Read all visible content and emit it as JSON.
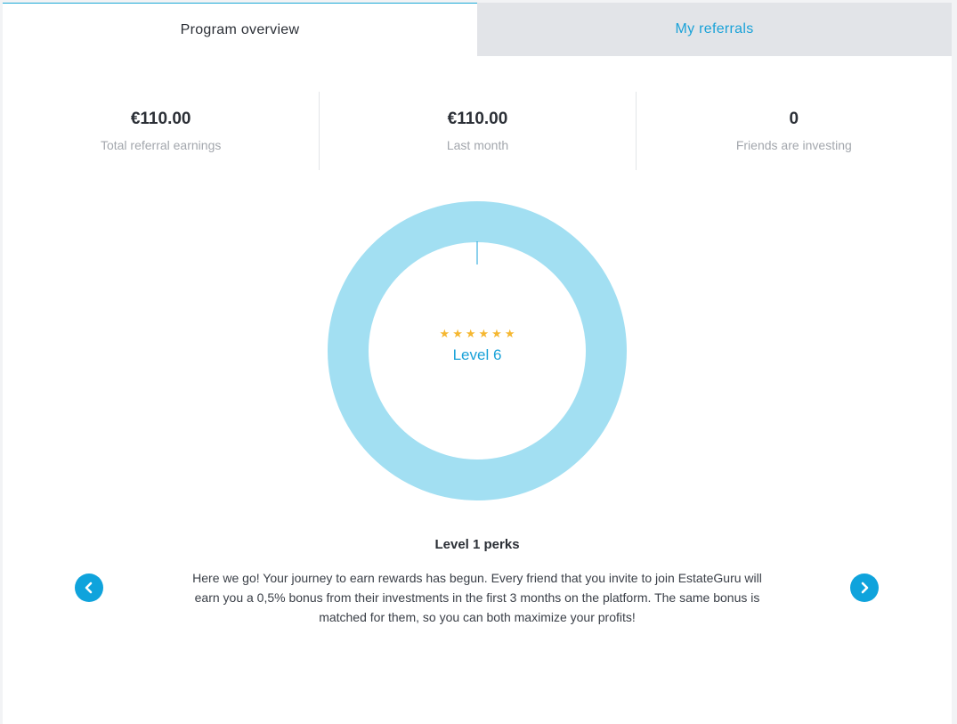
{
  "tabs": [
    {
      "label": "Program overview",
      "active": true
    },
    {
      "label": "My referrals",
      "active": false
    }
  ],
  "stats": [
    {
      "value": "€110.00",
      "label": "Total referral earnings"
    },
    {
      "value": "€110.00",
      "label": "Last month"
    },
    {
      "value": "0",
      "label": "Friends are investing"
    }
  ],
  "level": {
    "label": "Level 6",
    "stars": 6,
    "progress": 0
  },
  "perks": {
    "title": "Level 1 perks",
    "text": "Here we go! Your journey to earn rewards has begun. Every friend that you invite to join EstateGuru will earn you a 0,5% bonus from their investments in the first 3 months on the platform. The same bonus is matched for them, so you can both maximize your profits!"
  },
  "colors": {
    "accent": "#1aa2d8",
    "ring": "#a2dff2",
    "star": "#f5b731",
    "nav_button": "#0fa3dc"
  },
  "icons": {
    "prev": "chevron-left-icon",
    "next": "chevron-right-icon",
    "star": "star-icon"
  }
}
